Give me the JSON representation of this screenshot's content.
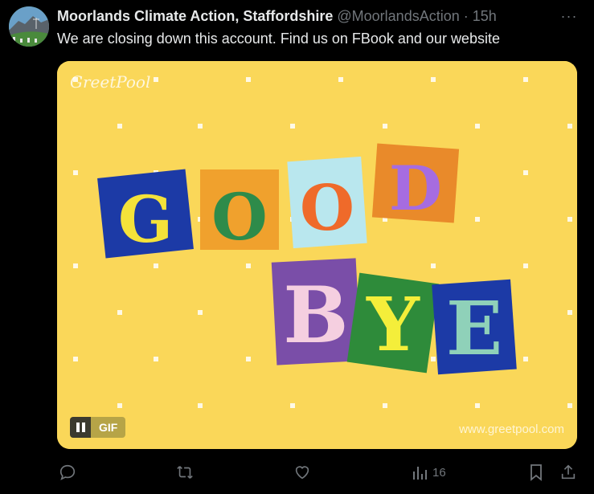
{
  "tweet": {
    "author_name": "Moorlands Climate Action, Staffordshire",
    "handle": "@MoorlandsAction",
    "separator": "·",
    "time": "15h",
    "text": "We are closing down this account. Find us on FBook and our website",
    "more_label": "···"
  },
  "media": {
    "type": "gif",
    "brand": "GreetPool",
    "letters_top": [
      "G",
      "O",
      "O",
      "D"
    ],
    "letters_bottom": [
      "B",
      "Y",
      "E"
    ],
    "gif_badge": "GIF",
    "watermark": "www.greetpool.com",
    "background_color": "#fad759"
  },
  "actions": {
    "reply_icon": "reply-icon",
    "retweet_icon": "retweet-icon",
    "like_icon": "heart-icon",
    "views_icon": "views-icon",
    "views_count": "16",
    "bookmark_icon": "bookmark-icon",
    "share_icon": "share-icon"
  }
}
